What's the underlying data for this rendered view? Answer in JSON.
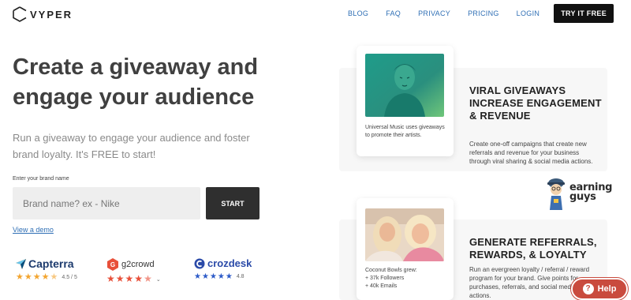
{
  "header": {
    "brand": "VYPER",
    "nav": [
      {
        "label": "BLOG"
      },
      {
        "label": "FAQ"
      },
      {
        "label": "PRIVACY"
      },
      {
        "label": "PRICING"
      },
      {
        "label": "LOGIN"
      }
    ],
    "cta_label": "TRY IT FREE"
  },
  "hero": {
    "headline": "Create a giveaway and engage your audience",
    "subhead": "Run a giveaway to engage your audience and foster brand loyalty. It's FREE to start!",
    "field_label": "Enter your brand name",
    "input_placeholder": "Brand name? ex - Nike",
    "input_value": "",
    "start_label": "START",
    "demo_link": "View a demo"
  },
  "reviews": [
    {
      "name": "Capterra",
      "rating": "4.5 / 5",
      "stars": 4.5,
      "color": "#f3a530"
    },
    {
      "name": "g2crowd",
      "rating": "",
      "stars": 4.5,
      "color": "#e8503a"
    },
    {
      "name": "crozdesk",
      "rating": "4.8",
      "stars": 5,
      "color": "#2d5bc8"
    }
  ],
  "features": [
    {
      "card_caption": "Universal Music uses giveaways to promote their artists.",
      "title": "VIRAL GIVEAWAYS INCREASE ENGAGEMENT & REVENUE",
      "description": "Create one-off campaigns that create new referrals and revenue for your business through viral sharing & social media actions."
    },
    {
      "card_caption": "Coconut Bowls grew:\n+ 37k Followers\n+ 40k Emails",
      "title": "GENERATE REFERRALS, REWARDS, & LOYALTY",
      "description": "Run an evergreen loyalty / referral / reward program for your brand. Give points for purchases, referrals, and social media actions."
    }
  ],
  "watermark": {
    "line1": "earning",
    "line2": "guys"
  },
  "help": {
    "label": "Help"
  },
  "colors": {
    "accent_link": "#2f6fb5",
    "cta_bg": "#111111",
    "help_bg": "#c94b3e",
    "panel_bg": "#f7f7f7"
  }
}
